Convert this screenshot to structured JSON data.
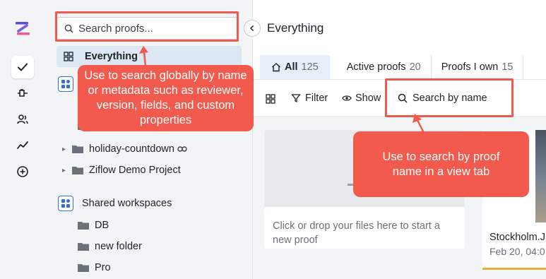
{
  "colors": {
    "accent_highlight": "#ef5a4f",
    "selected_bg": "#dde7f3",
    "brand": "#5b4ee0",
    "workspace_blue": "#2f6fd6"
  },
  "rail": {
    "items": [
      {
        "icon": "check-icon"
      },
      {
        "icon": "plug-icon"
      },
      {
        "icon": "users-icon"
      },
      {
        "icon": "activity-icon"
      },
      {
        "icon": "add-circle-icon"
      }
    ]
  },
  "sidebar": {
    "search_placeholder": "Search proofs...",
    "everything_label": "Everything",
    "tree": [
      {
        "label": "holiday-countdown",
        "linked": true
      },
      {
        "label": "Ziflow Demo Project",
        "linked": false
      }
    ],
    "shared_workspaces_label": "Shared workspaces",
    "shared_folders": [
      "DB",
      "new folder",
      "Pro"
    ]
  },
  "main": {
    "title": "Everything",
    "tabs": [
      {
        "label": "All",
        "count": "125"
      },
      {
        "label": "Active proofs",
        "count": "20"
      },
      {
        "label": "Proofs I own",
        "count": "15"
      }
    ],
    "toolbar": {
      "filter_label": "Filter",
      "show_label": "Show",
      "name_search_placeholder": "Search by name"
    },
    "drop_card_text": "Click or drop your files here to start a new proof",
    "proof_card": {
      "name": "Stockholm.J",
      "date": "Feb 20, 04:0"
    }
  },
  "callouts": {
    "global_search": "Use to search globally by name or metadata such as reviewer, version, fields, and custom properties",
    "view_search": "Use to search by proof name in a view tab"
  }
}
